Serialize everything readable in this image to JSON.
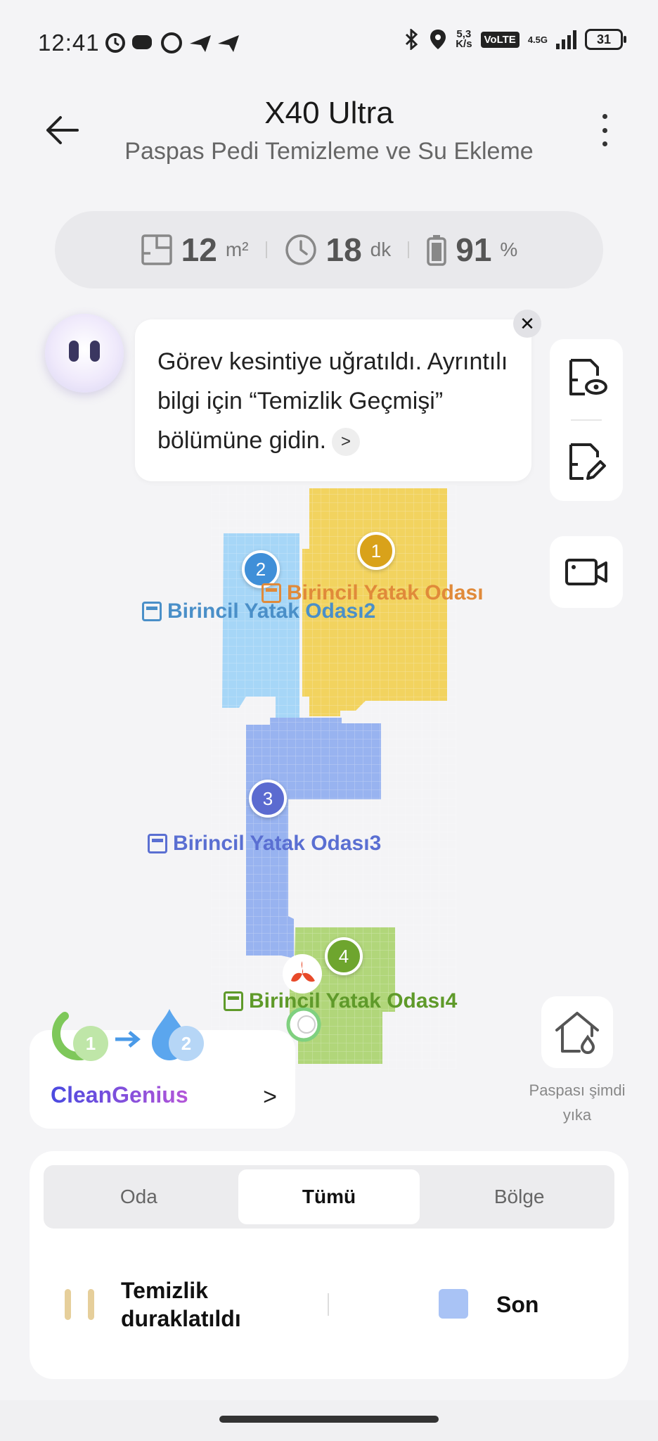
{
  "status_bar": {
    "time": "12:41",
    "net_speed_top": "5,3",
    "net_speed_bottom": "K/s",
    "volte": "VoLTE",
    "network": "4.5G",
    "battery": "31"
  },
  "header": {
    "title": "X40 Ultra",
    "subtitle": "Paspas Pedi Temizleme ve Su Ekleme"
  },
  "stats": {
    "area_value": "12",
    "area_unit": "m²",
    "time_value": "18",
    "time_unit": "dk",
    "battery_value": "91",
    "battery_unit": "%"
  },
  "assistant": {
    "message": "Görev kesintiye uğratıldı. Ayrıntılı bilgi için “Temizlik Geçmişi” bölümüne gidin.",
    "arrow": ">",
    "close": "✕"
  },
  "map": {
    "rooms": [
      {
        "num": "1",
        "name": "Birincil Yatak Odası",
        "color": "#f2d35f",
        "pin": "#d9a21a",
        "text": "#e08a3a"
      },
      {
        "num": "2",
        "name": "Birincil Yatak Odası2",
        "color": "#a6d6f7",
        "pin": "#3f8fd8",
        "text": "#4a8fc8"
      },
      {
        "num": "3",
        "name": "Birincil Yatak Odası3",
        "color": "#98b3f0",
        "pin": "#5b6bd0",
        "text": "#5a6fd2"
      },
      {
        "num": "4",
        "name": "Birincil Yatak Odası4",
        "color": "#b1d67a",
        "pin": "#6ea52e",
        "text": "#5f9a2a"
      }
    ]
  },
  "clean_genius": {
    "label": "CleanGenius",
    "step1": "1",
    "step2": "2",
    "chevron": ">"
  },
  "wash_mop": {
    "label": "Paspası şimdi yıka"
  },
  "tabs": [
    {
      "label": "Oda",
      "active": false
    },
    {
      "label": "Tümü",
      "active": true
    },
    {
      "label": "Bölge",
      "active": false
    }
  ],
  "status": {
    "text": "Temizlik duraklatıldı",
    "mode": "Son",
    "mode_color": "#a9c3f5"
  }
}
